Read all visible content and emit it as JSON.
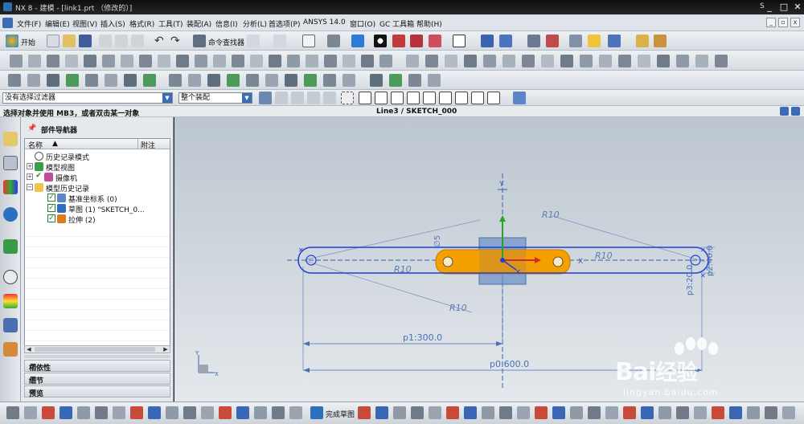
{
  "window": {
    "title": "NX 8 - 建模 - [link1.prt （修改的）]",
    "s_label": "S",
    "controls": [
      "_",
      "□",
      "✕"
    ]
  },
  "menu": {
    "items": [
      "文件(F)",
      "编辑(E)",
      "视图(V)",
      "插入(S)",
      "格式(R)",
      "工具(T)",
      "装配(A)",
      "信息(I)",
      "分析(L)",
      "首选项(P)",
      "ANSYS 14.0",
      "窗口(O)",
      "GC 工具箱",
      "帮助(H)"
    ]
  },
  "toolbar": {
    "start_label": "开始",
    "command_finder_label": "命令查找器",
    "filter_select": "没有选择过滤器",
    "assembly_select": "整个装配"
  },
  "status": {
    "prompt": "选择对象并使用 MB3，或者双击某一对象",
    "selection": "Line3 / SKETCH_000"
  },
  "navigator": {
    "title": "部件导航器",
    "columns": [
      "名称",
      "附注"
    ],
    "tree": [
      {
        "label": "历史记录模式",
        "icon": "clock-icon"
      },
      {
        "label": "模型视图",
        "icon": "model-views-icon"
      },
      {
        "label": "摄像机",
        "icon": "camera-icon"
      },
      {
        "label": "模型历史记录",
        "icon": "folder-icon"
      },
      {
        "label": "基准坐标系 (0)",
        "icon": "datum-csys-icon"
      },
      {
        "label": "草图 (1) \"SKETCH_0...",
        "icon": "sketch-icon"
      },
      {
        "label": "拉伸 (2)",
        "icon": "extrude-icon"
      }
    ],
    "sections": [
      "相依性",
      "细节",
      "预览"
    ]
  },
  "sketch": {
    "dimensions": {
      "p0": "p0:600.0",
      "p1": "p1:300.0",
      "p2": "p2:40.0",
      "p3": "p3:20.0"
    },
    "radius_labels": [
      "R10",
      "R10",
      "R10",
      "R10"
    ],
    "phi_label": "∅5",
    "x_label": "X",
    "y_label": "Y",
    "small_x": "X",
    "small_y": "Y"
  },
  "bottom": {
    "finish_sketch_label": "完成草图"
  },
  "watermark": {
    "brand_a": "Bai",
    "brand_cn": "经验",
    "url": "jingyan.baidu.com"
  },
  "colors": {
    "sketch_blue": "#1f3fd0",
    "dim_blue": "#4a6fb8",
    "body_orange": "#f4a000",
    "csys_green": "#2aa12a",
    "csys_red": "#d12a2a",
    "plane_blue": "#6f93c9"
  }
}
